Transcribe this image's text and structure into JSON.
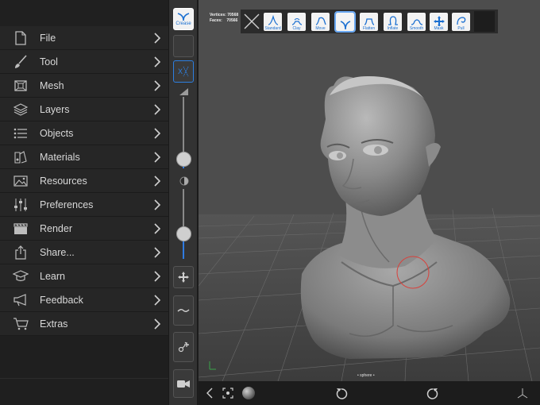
{
  "menu": {
    "items": [
      {
        "id": "file",
        "label": "File",
        "icon": "file-icon"
      },
      {
        "id": "tool",
        "label": "Tool",
        "icon": "brush-icon"
      },
      {
        "id": "mesh",
        "label": "Mesh",
        "icon": "mesh-icon"
      },
      {
        "id": "layers",
        "label": "Layers",
        "icon": "layers-icon"
      },
      {
        "id": "objects",
        "label": "Objects",
        "icon": "list-icon"
      },
      {
        "id": "materials",
        "label": "Materials",
        "icon": "materials-icon"
      },
      {
        "id": "resources",
        "label": "Resources",
        "icon": "image-icon"
      },
      {
        "id": "preferences",
        "label": "Preferences",
        "icon": "sliders-icon"
      },
      {
        "id": "render",
        "label": "Render",
        "icon": "clapper-icon"
      },
      {
        "id": "share",
        "label": "Share...",
        "icon": "share-icon"
      },
      {
        "id": "learn",
        "label": "Learn",
        "icon": "graduation-cap-icon"
      },
      {
        "id": "feedback",
        "label": "Feedback",
        "icon": "megaphone-icon"
      },
      {
        "id": "extras",
        "label": "Extras",
        "icon": "cart-icon"
      }
    ]
  },
  "toolstrip": {
    "crease_label": "Crease",
    "symmetry_label": "X",
    "radius_level": 0.12,
    "intensity_level": 0.35
  },
  "viewport": {
    "vertices_label": "Vertices:",
    "vertices_value": "70568",
    "faces_label": "Faces:",
    "faces_value": "70566",
    "object_label": "• sphere •",
    "brushes": [
      {
        "id": "standard",
        "label": "Standard"
      },
      {
        "id": "clay",
        "label": "Clay"
      },
      {
        "id": "move",
        "label": "Move"
      },
      {
        "id": "crease",
        "label": "",
        "active": true
      },
      {
        "id": "flatten",
        "label": "Flatten"
      },
      {
        "id": "inflate",
        "label": "Inflate"
      },
      {
        "id": "smooth",
        "label": "Smooth"
      },
      {
        "id": "mask",
        "label": "Mask"
      },
      {
        "id": "pull",
        "label": "Pull"
      }
    ]
  },
  "colors": {
    "accent": "#2d7fe0",
    "panel": "#262626",
    "viewport": "#4d4d4d"
  }
}
